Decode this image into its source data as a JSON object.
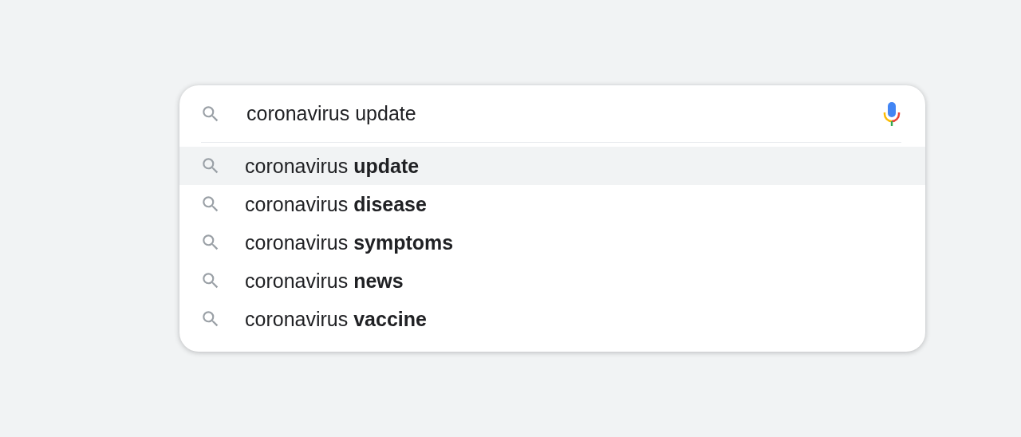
{
  "search": {
    "value": "coronavirus update"
  },
  "suggestions": [
    {
      "text": "coronavirus **update**",
      "selected": true
    },
    {
      "text": "coronavirus **disease**",
      "selected": false
    },
    {
      "text": "coronavirus **symptoms**",
      "selected": false
    },
    {
      "text": "coronavirus **news**",
      "selected": false
    },
    {
      "text": "coronavirus **vaccine**",
      "selected": false
    }
  ]
}
